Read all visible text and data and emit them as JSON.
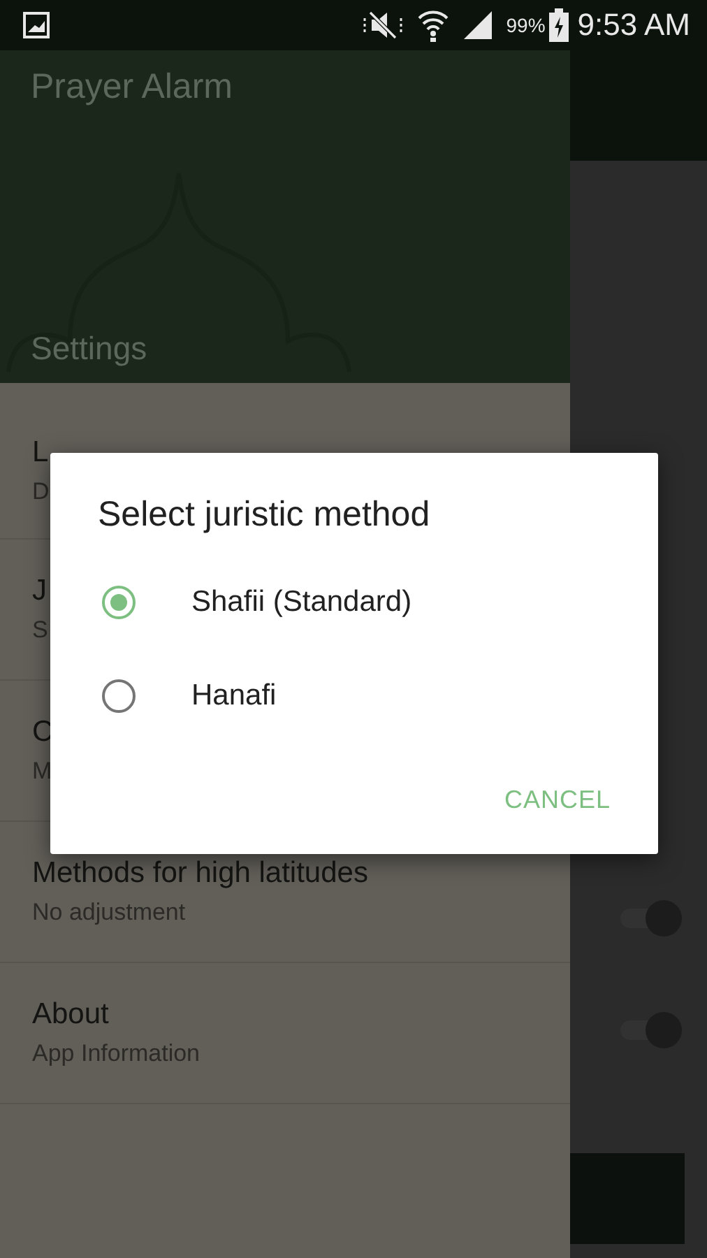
{
  "status_bar": {
    "battery": "99%",
    "time": "9:53 AM"
  },
  "drawer": {
    "app_title": "Prayer Alarm",
    "section": "Settings",
    "items": [
      {
        "title": "L",
        "subtitle": "D"
      },
      {
        "title": "J",
        "subtitle": "S"
      },
      {
        "title": "C",
        "subtitle": "M"
      },
      {
        "title": "Methods for high latitudes",
        "subtitle": "No adjustment"
      },
      {
        "title": "About",
        "subtitle": "App Information"
      }
    ]
  },
  "background_switches": [
    {
      "on": true
    },
    {
      "on": true
    }
  ],
  "dialog": {
    "title": "Select juristic method",
    "options": [
      {
        "label": "Shafii (Standard)",
        "selected": true
      },
      {
        "label": "Hanafi",
        "selected": false
      }
    ],
    "buttons": [
      "CANCEL"
    ]
  }
}
